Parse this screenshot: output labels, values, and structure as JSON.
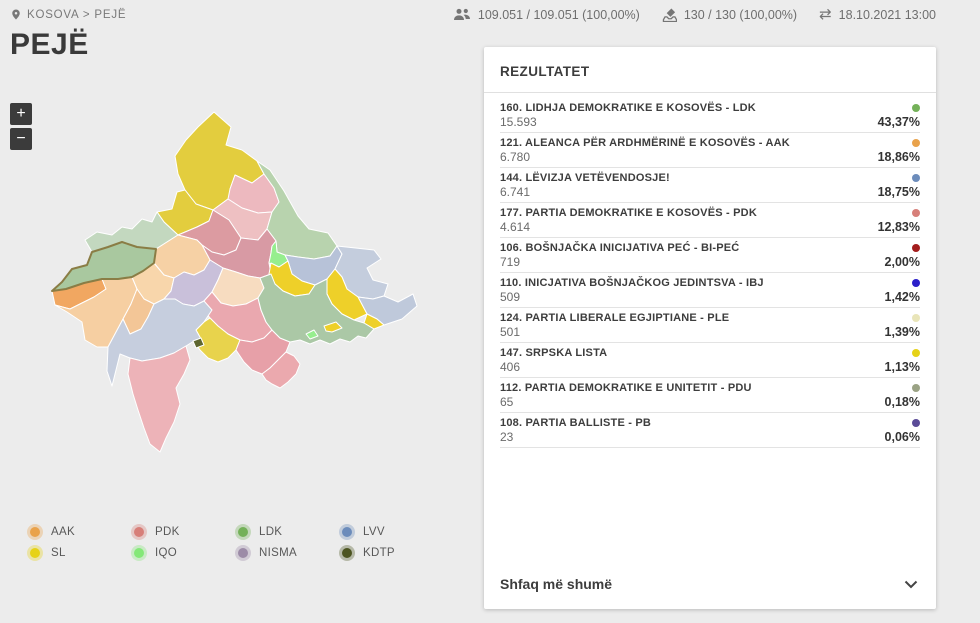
{
  "breadcrumb": {
    "location_label": "KOSOVA > PEJË"
  },
  "page_title": "PEJË",
  "topbar": {
    "voters_count": "109.051 / 109.051 (100,00%)",
    "polling_stations": "130 / 130 (100,00%)",
    "last_updated": "18.10.2021 13:00"
  },
  "map": {
    "zoom_in_label": "+",
    "zoom_out_label": "−",
    "selected_region": "PEJË",
    "legend": [
      {
        "label": "AAK",
        "color": "#e9a24b"
      },
      {
        "label": "PDK",
        "color": "#d77f79"
      },
      {
        "label": "LDK",
        "color": "#74b159"
      },
      {
        "label": "LVV",
        "color": "#6c8cbb"
      },
      {
        "label": "SL",
        "color": "#e6d217"
      },
      {
        "label": "IQO",
        "color": "#84e878"
      },
      {
        "label": "NISMA",
        "color": "#9c8ba7"
      },
      {
        "label": "KDTP",
        "color": "#4c5420"
      }
    ]
  },
  "results": {
    "title": "REZULTATET",
    "show_more_label": "Shfaq më shumë",
    "rows": [
      {
        "name": "160. LIDHJA DEMOKRATIKE E KOSOVËS - LDK",
        "votes": "15.593",
        "percent": "43,37%",
        "color": "#74b159"
      },
      {
        "name": "121. ALEANCA PËR ARDHMËRINË E KOSOVËS - AAK",
        "votes": "6.780",
        "percent": "18,86%",
        "color": "#e9a24b"
      },
      {
        "name": "144. LËVIZJA VETËVENDOSJE!",
        "votes": "6.741",
        "percent": "18,75%",
        "color": "#6c8cbb"
      },
      {
        "name": "177. PARTIA DEMOKRATIKE E KOSOVËS - PDK",
        "votes": "4.614",
        "percent": "12,83%",
        "color": "#d77f79"
      },
      {
        "name": "106. BOŠNJAČKA INICIJATIVA PEĆ - BI-PEĆ",
        "votes": "719",
        "percent": "2,00%",
        "color": "#a31d1d"
      },
      {
        "name": "110. INICJATIVA BOŠNJAČKOG JEDINTSVA - IBJ",
        "votes": "509",
        "percent": "1,42%",
        "color": "#2b1fc9"
      },
      {
        "name": "124. PARTIA LIBERALE EGJIPTIANE - PLE",
        "votes": "501",
        "percent": "1,39%",
        "color": "#e9e5b9"
      },
      {
        "name": "147. SRPSKA LISTA",
        "votes": "406",
        "percent": "1,13%",
        "color": "#e6d217"
      },
      {
        "name": "112. PARTIA DEMOKRATIKE E UNITETIT - PDU",
        "votes": "65",
        "percent": "0,18%",
        "color": "#9aa284"
      },
      {
        "name": "108. PARTIA BALLISTE - PB",
        "votes": "23",
        "percent": "0,06%",
        "color": "#5a4b97"
      }
    ]
  }
}
